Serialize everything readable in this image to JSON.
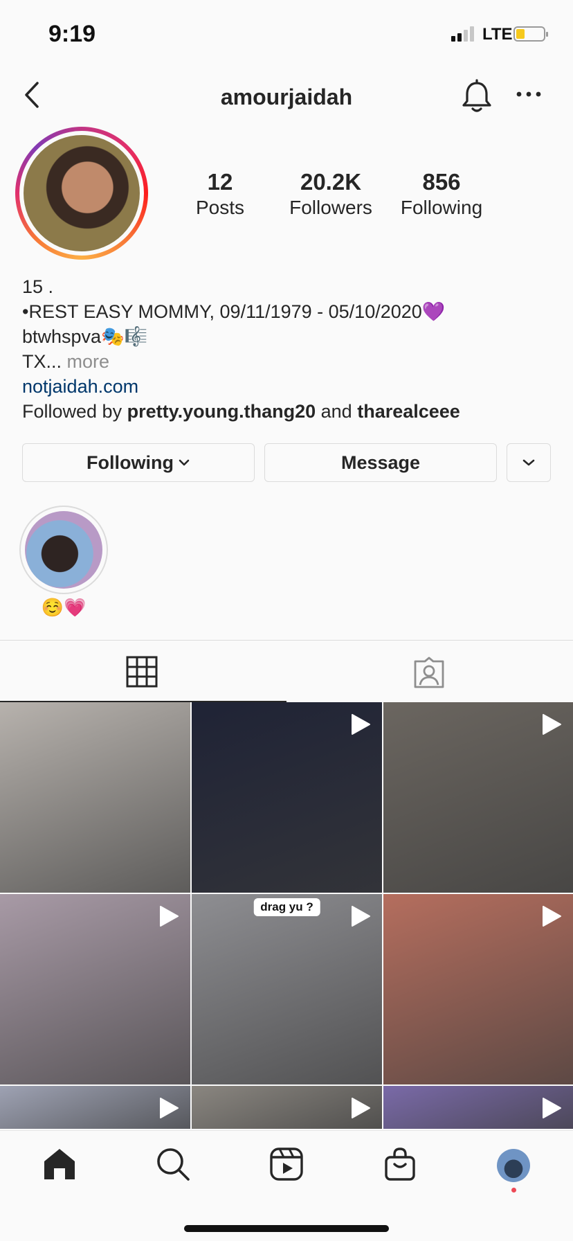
{
  "status_bar": {
    "time": "9:19",
    "network": "LTE",
    "battery_level": 0.25
  },
  "header": {
    "username": "amourjaidah"
  },
  "stats": [
    {
      "value": "12",
      "label": "Posts"
    },
    {
      "value": "20.2K",
      "label": "Followers"
    },
    {
      "value": "856",
      "label": "Following"
    }
  ],
  "bio": {
    "line1": "15 .",
    "line2": "•REST EASY MOMMY, 09/11/1979 - 05/10/2020💜",
    "line3": "btwhspva🎭🎼",
    "line4_text": "TX...",
    "line4_more": "more",
    "website": "notjaidah.com",
    "followed_by_prefix": "Followed by",
    "followed_by_user1": "pretty.young.thang20",
    "followed_by_and": "and",
    "followed_by_user2": "tharealceee"
  },
  "buttons": {
    "following": "Following",
    "following_chevron": "⌄",
    "message": "Message",
    "dropdown": "⌄"
  },
  "highlight": {
    "label": "☺️💗"
  },
  "grid": {
    "posts": [
      {
        "type": "photo",
        "bg": "#b7b2ad",
        "caption": ""
      },
      {
        "type": "video",
        "bg": "#1f2336",
        "caption": ""
      },
      {
        "type": "video",
        "bg": "#6b6660",
        "caption": ""
      },
      {
        "type": "video",
        "bg": "#a89aa6",
        "caption": ""
      },
      {
        "type": "video",
        "bg": "#8e8e92",
        "caption": "drag yu ?"
      },
      {
        "type": "video",
        "bg": "#b56e5e",
        "caption": ""
      },
      {
        "type": "video",
        "bg": "#9ea2b3",
        "caption": ""
      },
      {
        "type": "video",
        "bg": "#8a8680",
        "caption": ""
      },
      {
        "type": "video",
        "bg": "#7a6aa8",
        "caption": ""
      }
    ]
  },
  "colors": {
    "link": "#00376b",
    "muted": "#8e8e8e",
    "notification_dot": "#ed4956"
  }
}
